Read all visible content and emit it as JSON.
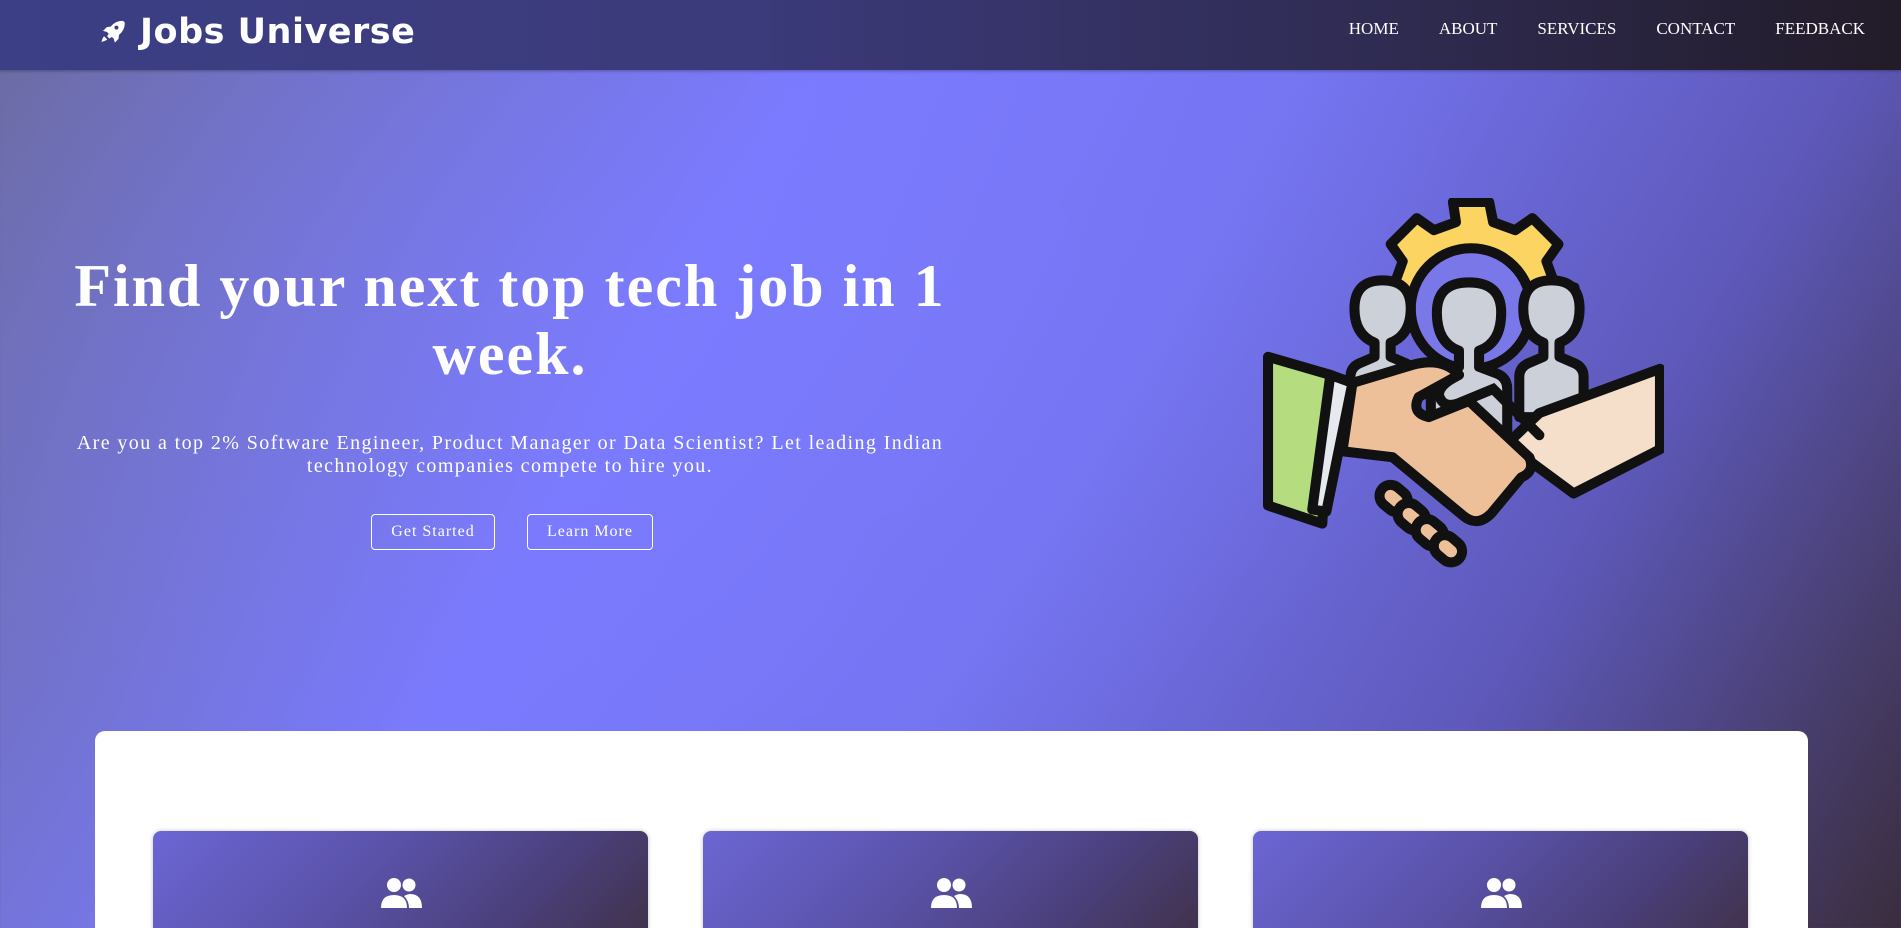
{
  "brand": {
    "name": "Jobs Universe",
    "icon": "rocket-icon"
  },
  "nav": {
    "items": [
      {
        "label": "HOME"
      },
      {
        "label": "ABOUT"
      },
      {
        "label": "SERVICES"
      },
      {
        "label": "CONTACT"
      },
      {
        "label": "FEEDBACK"
      }
    ]
  },
  "hero": {
    "title": "Find your next top tech job in 1 week.",
    "subtitle": "Are you a top 2% Software Engineer, Product Manager or Data Scientist? Let leading Indian technology companies compete to hire you.",
    "primary_button": "Get Started",
    "secondary_button": "Learn More",
    "illustration": "handshake-teamwork-icon"
  },
  "cards": [
    {
      "icon": "users-icon"
    },
    {
      "icon": "users-icon"
    },
    {
      "icon": "users-icon"
    }
  ],
  "colors": {
    "accent": "#7a7aff",
    "navbar": "#3b3a7a",
    "card_gradient_start": "#6b66d4",
    "card_gradient_end": "#3e2f3f"
  }
}
